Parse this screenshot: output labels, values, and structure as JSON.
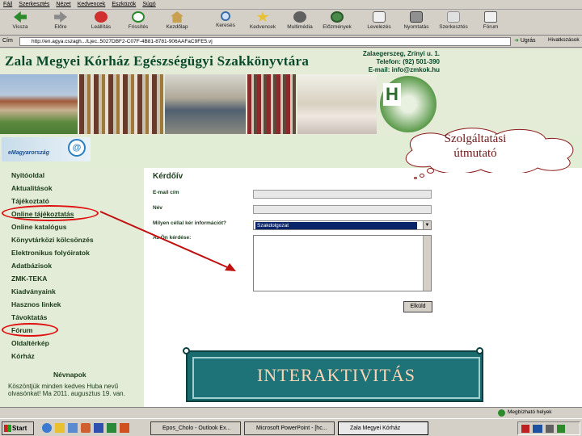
{
  "menubar": [
    "Fájl",
    "Szerkesztés",
    "Nézet",
    "Kedvencek",
    "Eszközök",
    "Súgó"
  ],
  "toolbar": [
    {
      "label": "Vissza",
      "icon": "back-arrow-icon"
    },
    {
      "label": "Előre",
      "icon": "forward-arrow-icon"
    },
    {
      "label": "Leállítás",
      "icon": "stop-icon"
    },
    {
      "label": "Frissítés",
      "icon": "refresh-icon"
    },
    {
      "label": "Kezdőlap",
      "icon": "home-icon"
    },
    {
      "label": "Keresés",
      "icon": "search-icon"
    },
    {
      "label": "Kedvencek",
      "icon": "favorites-icon"
    },
    {
      "label": "Multimédia",
      "icon": "media-icon"
    },
    {
      "label": "Előzmények",
      "icon": "history-icon"
    },
    {
      "label": "Levelezés",
      "icon": "mail-icon"
    },
    {
      "label": "Nyomtatás",
      "icon": "print-icon"
    },
    {
      "label": "Szerkesztés",
      "icon": "edit-icon"
    },
    {
      "label": "Fórum",
      "icon": "discuss-icon"
    }
  ],
  "address": {
    "label": "Cím",
    "url": "http://en.agya.cszagh.../Ljec..5027DBF2-C07F-4B81-8781-906AAFaC9FE5.vj",
    "go": "Ugrás",
    "links": "Hivatkozások"
  },
  "site": {
    "title": "Zala Megyei Kórház Egészségügyi Szakkönyvtára",
    "contact": [
      "Zalaegerszeg, Zrínyi u. 1.",
      "Telefon: (92) 501-390",
      "E-mail: info@zmkok.hu"
    ],
    "emagyar": "eMagyarország",
    "emagyar_logo": "@"
  },
  "sidebar": {
    "items": [
      "Nyitóoldal",
      "Aktualitások",
      "Tájékoztató",
      "Online tájékoztatás",
      "Online katalógus",
      "Könyvtárközi kölcsönzés",
      "Elektronikus folyóiratok",
      "Adatbázisok",
      "ZMK-TEKA",
      "Kiadványaink",
      "Hasznos linkek",
      "Távoktatás",
      "Fórum",
      "Oldaltérkép",
      "Kórház"
    ],
    "nevnapok_title": "Névnapok",
    "nevnapok_text": "Köszöntjük minden kedves Huba nevű olvasónkat! Ma 2011. augusztus 19. van."
  },
  "form": {
    "title": "Kérdőív",
    "email_label": "E-mail cím",
    "name_label": "Név",
    "topic_label": "Milyen céllal kér információt?",
    "topic_value": "Szakdolgozat",
    "question_label": "Az Ön kérdése:",
    "submit_label": "Elküld"
  },
  "annotations": {
    "cloud_text": "Szolgáltatási útmutató",
    "banner_text": "INTERAKTIVITÁS"
  },
  "statusbar": {
    "zone": "Megbízható helyek"
  },
  "taskbar": {
    "start": "Start",
    "tasks": [
      "Epos_Cholo - Outlook Ex...",
      "Microsoft PowerPoint - [hc...",
      "Zala Megyei Kórház"
    ]
  }
}
